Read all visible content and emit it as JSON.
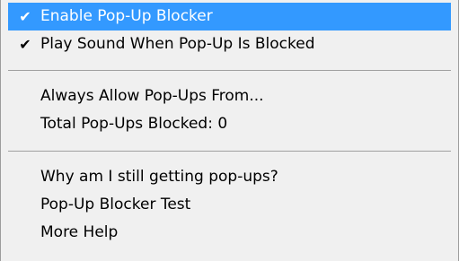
{
  "menu": {
    "items": [
      {
        "label": "Enable Pop-Up Blocker",
        "checked": true,
        "highlighted": true,
        "check_icon": "checkmark-icon"
      },
      {
        "label": "Play Sound When Pop-Up Is Blocked",
        "checked": true,
        "highlighted": false,
        "check_icon": "checkmark-icon"
      },
      {
        "label": "Always Allow Pop-Ups From...",
        "checked": false
      },
      {
        "label": "Total Pop-Ups Blocked: 0",
        "checked": false
      },
      {
        "label": "Why am I still getting pop-ups?",
        "checked": false
      },
      {
        "label": "Pop-Up Blocker Test",
        "checked": false
      },
      {
        "label": "More Help",
        "checked": false
      }
    ],
    "check_glyph": "✔"
  },
  "colors": {
    "highlight_bg": "#3399ff",
    "highlight_text": "#ffffff",
    "menu_bg": "#f0f0f0",
    "separator": "#a0a0a0"
  }
}
